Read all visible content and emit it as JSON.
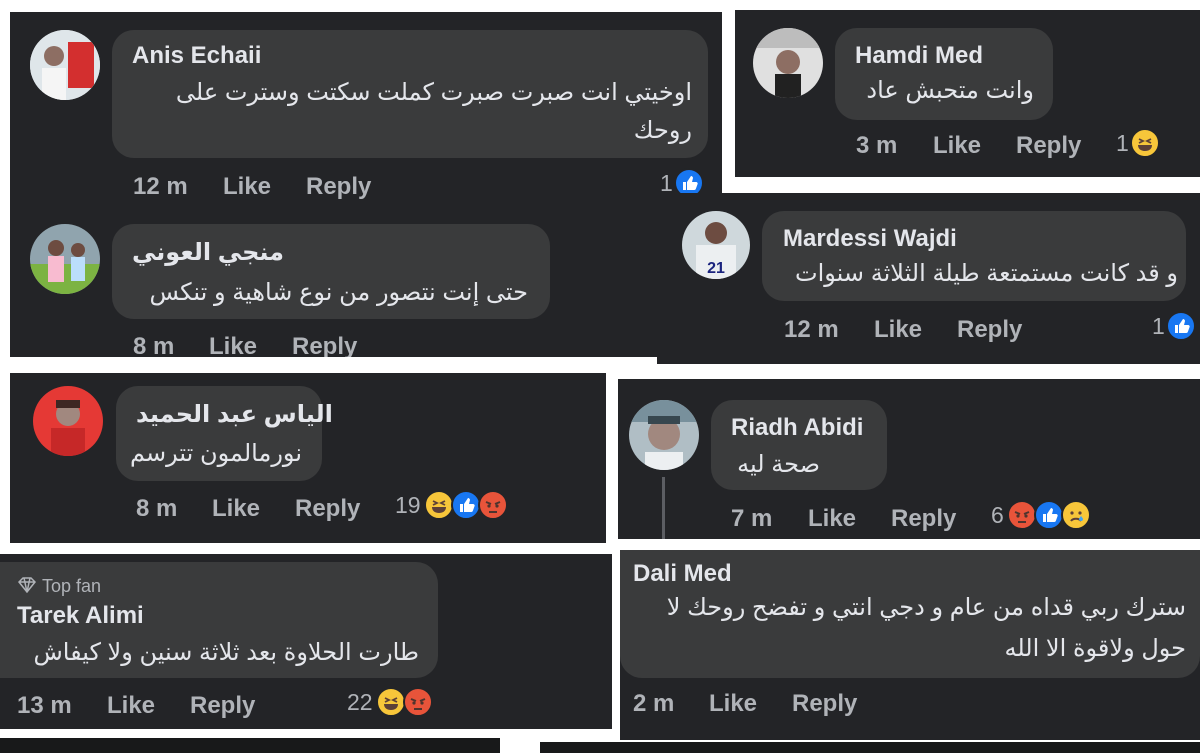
{
  "comments": [
    {
      "name": "Anis Echaii",
      "text_lines": [
        "اوخيتي انت صبرت صبرت كملت سكتت وسترت على",
        "روحك"
      ],
      "time": "12 m",
      "like": "Like",
      "reply": "Reply",
      "count": "1"
    },
    {
      "name": "منجي العوني",
      "text_lines": [
        "حتى إنت نتصور من نوع شاهية و تنكس"
      ],
      "time": "8 m",
      "like": "Like",
      "reply": "Reply"
    },
    {
      "name": "Hamdi Med",
      "text_lines": [
        "وانت متحبش عاد"
      ],
      "time": "3 m",
      "like": "Like",
      "reply": "Reply",
      "count": "1"
    },
    {
      "name": "Mardessi Wajdi",
      "text_lines": [
        "و قد كانت مستمتعة طيلة الثلاثة سنوات"
      ],
      "time": "12 m",
      "like": "Like",
      "reply": "Reply",
      "count": "1"
    },
    {
      "name": "الياس عبد الحميد",
      "text_lines": [
        "نورمالمون تترسم"
      ],
      "time": "8 m",
      "like": "Like",
      "reply": "Reply",
      "count": "19"
    },
    {
      "name": "Riadh Abidi",
      "text_lines": [
        "صحة ليه"
      ],
      "time": "7 m",
      "like": "Like",
      "reply": "Reply",
      "count": "6"
    },
    {
      "name": "Tarek Alimi",
      "badge": "Top fan",
      "text_lines": [
        "طارت الحلاوة بعد ثلاثة سنين ولا كيفاش"
      ],
      "time": "13 m",
      "like": "Like",
      "reply": "Reply",
      "count": "22"
    },
    {
      "name": "Dali Med",
      "text_lines": [
        "سترك ربي قداه من عام و دجي انتي و تفضح روحك لا",
        "حول ولاقوة الا الله"
      ],
      "time": "2 m",
      "like": "Like",
      "reply": "Reply"
    }
  ],
  "icons": {
    "badge": "diamond-icon",
    "reactions": [
      "haha-icon",
      "like-icon",
      "angry-icon",
      "sad-icon"
    ]
  },
  "colors": {
    "panel": "#232427",
    "bubble": "#3a3b3c",
    "like_blue": "#1877f2",
    "haha_yellow": "#f7c63a",
    "angry_red": "#e8543a"
  }
}
